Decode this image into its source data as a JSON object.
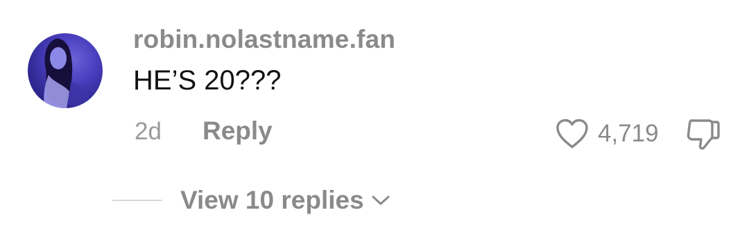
{
  "comment": {
    "username": "robin.nolastname.fan",
    "text": "HE’S 20???",
    "time_ago": "2d",
    "reply_label": "Reply",
    "like_count": "4,719",
    "avatar_icon": "user-avatar-photo"
  },
  "replies": {
    "view_label": "View 10 replies"
  },
  "icons": {
    "like": "heart-icon",
    "dislike": "thumbs-down-icon",
    "expand": "chevron-down-icon"
  },
  "colors": {
    "username": "#8a8a8a",
    "text": "#111111",
    "muted": "#9a9a9a",
    "divider": "#d8d8d8"
  }
}
